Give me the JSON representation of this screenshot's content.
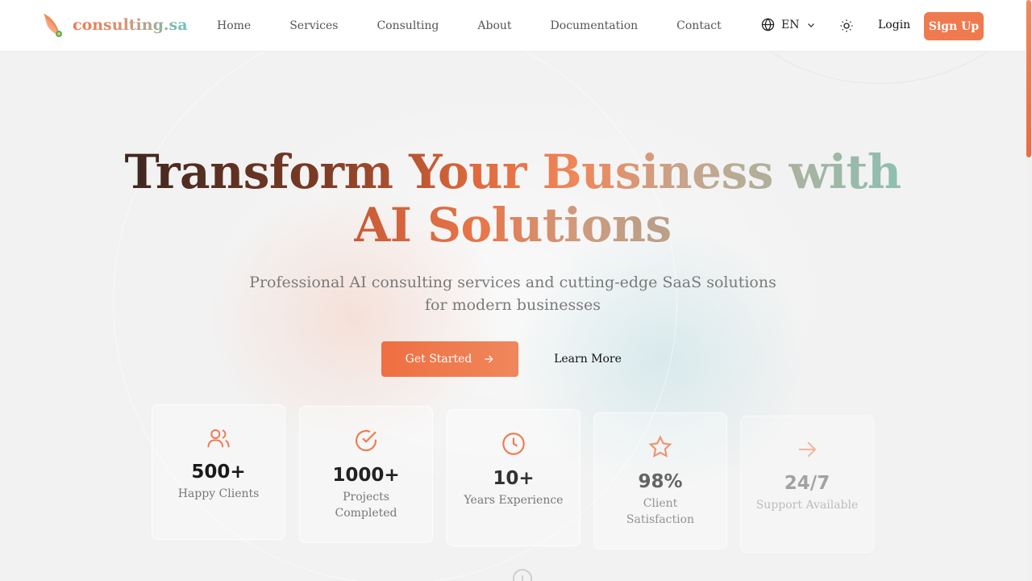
{
  "brand": {
    "name": "consulting.sa"
  },
  "nav": {
    "links": [
      "Home",
      "Services",
      "Consulting",
      "About",
      "Documentation",
      "Contact"
    ],
    "language": "EN",
    "login": "Login",
    "signup": "Sign Up"
  },
  "hero": {
    "title_line1": "Transform Your Business with",
    "title_line2": "AI Solutions",
    "subtitle": "Professional AI consulting services and cutting-edge SaaS solutions for modern businesses",
    "primary_cta": "Get Started",
    "secondary_cta": "Learn More"
  },
  "stats": [
    {
      "icon": "users-icon",
      "value": "500+",
      "label": "Happy Clients"
    },
    {
      "icon": "check-circle-icon",
      "value": "1000+",
      "label": "Projects Completed"
    },
    {
      "icon": "clock-icon",
      "value": "10+",
      "label": "Years Experience"
    },
    {
      "icon": "star-icon",
      "value": "98%",
      "label": "Client Satisfaction"
    },
    {
      "icon": "arrow-right-icon",
      "value": "24/7",
      "label": "Support Available"
    }
  ],
  "colors": {
    "accent": "#ef7a4f",
    "teal": "#69c6c0",
    "text_muted": "#7a7a7a"
  }
}
